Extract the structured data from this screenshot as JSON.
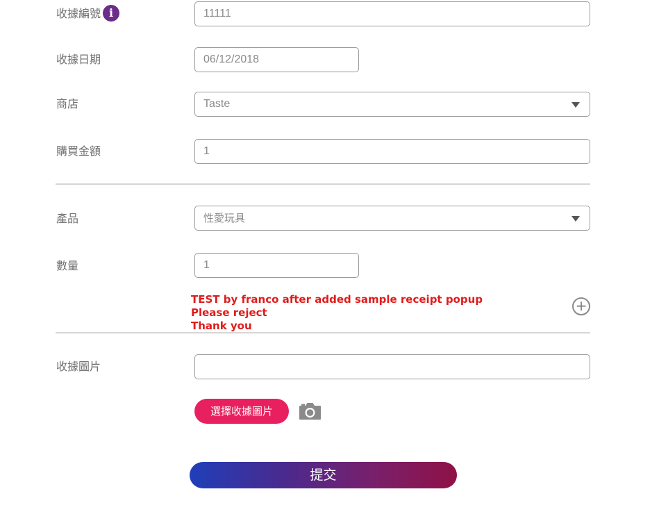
{
  "form": {
    "receipt_no": {
      "label": "收據編號",
      "value": "11111"
    },
    "receipt_date": {
      "label": "收據日期",
      "value": "06/12/2018"
    },
    "store": {
      "label": "商店",
      "value": "Taste"
    },
    "amount": {
      "label": "購買金額",
      "value": "1"
    },
    "product": {
      "label": "產品",
      "value": "性愛玩具"
    },
    "quantity": {
      "label": "數量",
      "value": "1"
    },
    "remark_lines": [
      "TEST by franco after added sample receipt popup",
      "Please reject",
      "Thank you"
    ],
    "receipt_image": {
      "label": "收據圖片",
      "value": ""
    },
    "choose_image_button": "選擇收據圖片",
    "submit_button": "提交"
  },
  "icons": {
    "info": "info-icon",
    "add": "plus-circle-icon",
    "camera": "camera-icon",
    "dropdown": "chevron-down-icon"
  },
  "colors": {
    "info_icon": "#6b2d8a",
    "remark_text": "#e01b1b",
    "choose_button": "#e8205f",
    "submit_gradient_start": "#1f3fb9",
    "submit_gradient_end": "#8f1146"
  }
}
